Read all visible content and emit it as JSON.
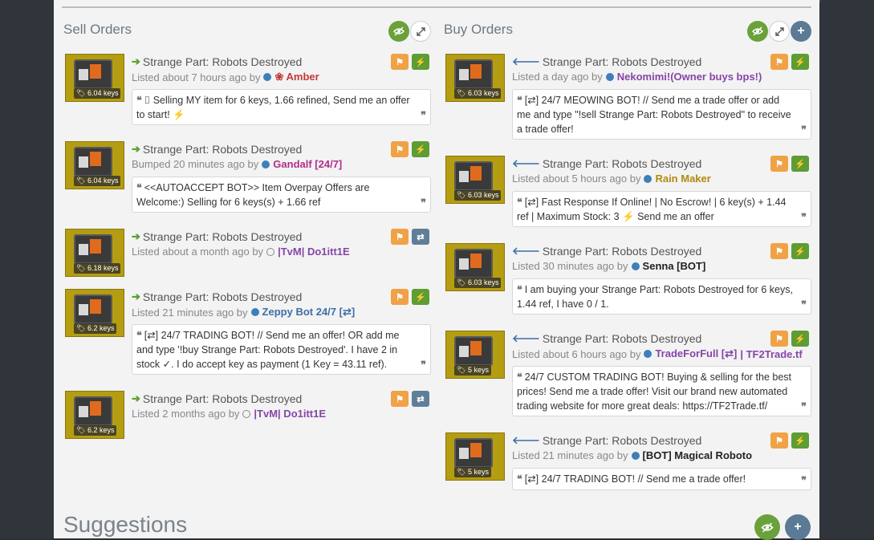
{
  "sell": {
    "title": "Sell Orders",
    "listings": [
      {
        "item": "Strange Part: Robots Destroyed",
        "price": "6.04 keys",
        "status": "Listed about 7 hours ago by",
        "user": "Amber",
        "user_prefix": "❀",
        "comment": "⌷ Selling MY item for 6 keys, 1.66 refined, Send me an offer to start! ⚡"
      },
      {
        "item": "Strange Part: Robots Destroyed",
        "price": "6.04 keys",
        "status": "Bumped 20 minutes ago by",
        "user": "Gandalf [24/7]",
        "comment": "<<AUTOACCEPT BOT>> Item Overpay Offers are Welcome:) Selling for 6 keys(s) + 1.66 ref"
      },
      {
        "item": "Strange Part: Robots Destroyed",
        "price": "6.18 keys",
        "status": "Listed about a month ago by",
        "user": "|TvM| Do1itt1E"
      },
      {
        "item": "Strange Part: Robots Destroyed",
        "price": "6.2 keys",
        "status": "Listed 21 minutes ago by",
        "user": "Zeppy Bot 24/7 [⇄]",
        "comment": "[⇄] 24/7 TRADING BOT! // Send me an offer! OR add me and type '!buy Strange Part: Robots Destroyed'. I have 2 in stock ✓. I do accept key as payment (1 Key = 43.11 ref)."
      },
      {
        "item": "Strange Part: Robots Destroyed",
        "price": "6.2 keys",
        "status": "Listed 2 months ago by",
        "user": "|TvM| Do1itt1E"
      }
    ]
  },
  "buy": {
    "title": "Buy Orders",
    "listings": [
      {
        "item": "Strange Part: Robots Destroyed",
        "price": "6.03 keys",
        "status": "Listed a day ago by",
        "user": "Nekomimi!(Owner buys bps!)",
        "comment": "[⇄] 24/7 MEOWING BOT! // Send me a trade offer or add me and type \"!sell Strange Part: Robots Destroyed\" to receive a trade offer!"
      },
      {
        "item": "Strange Part: Robots Destroyed",
        "price": "6.03 keys",
        "status": "Listed about 5 hours ago by",
        "user": "Rain Maker",
        "comment": "[⇄] Fast Response If Online! | No Escrow! | 6 key(s) + 1.44 ref | Maximum Stock: 3 ⚡ Send me an offer"
      },
      {
        "item": "Strange Part: Robots Destroyed",
        "price": "6.03 keys",
        "status": "Listed 30 minutes ago by",
        "user": "Senna [BOT]",
        "comment": "I am buying your Strange Part: Robots Destroyed for 6 keys, 1.44 ref, I have 0 / 1."
      },
      {
        "item": "Strange Part: Robots Destroyed",
        "price": "5 keys",
        "status": "Listed about 6 hours ago by",
        "user": "TradeForFull [⇄]",
        "user_suffix": "| TF2Trade.tf",
        "comment": "24/7 CUSTOM TRADING BOT! Buying & selling for the best prices! Send me a trade offer! Visit our brand new automated trading website for more great deals: https://TF2Trade.tf/"
      },
      {
        "item": "Strange Part: Robots Destroyed",
        "price": "5 keys",
        "status": "Listed 21 minutes ago by",
        "user": "[BOT] Magical Roboto",
        "comment": "[⇄] 24/7 TRADING BOT! // Send me a trade offer!"
      }
    ]
  },
  "suggestions": {
    "title": "Suggestions"
  },
  "colors": {
    "orange": "#f0a246",
    "green": "#5e9c34",
    "slate": "#5f7f98",
    "panel": "#f3f3f3"
  },
  "icons": {
    "sell_arrow": "arrow-right-icon",
    "buy_arrow": "arrow-left-icon",
    "flag": "flag-icon",
    "bolt": "bolt-icon",
    "trade": "exchange-icon",
    "eye": "eye-slash-icon",
    "expand": "expand-icon",
    "plus": "plus-icon"
  }
}
